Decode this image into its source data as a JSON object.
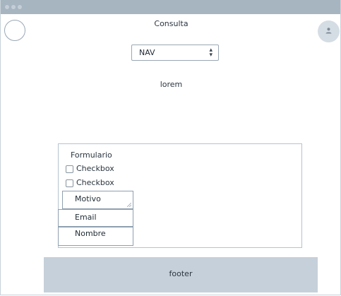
{
  "header": {
    "title": "Consulta",
    "logo_icon": "circle-logo-icon",
    "avatar_icon": "user-icon"
  },
  "nav": {
    "selected": "NAV",
    "caret_icon": "updown-caret-icon"
  },
  "main": {
    "text": "lorem"
  },
  "form": {
    "title": "Formulario",
    "checkboxes": [
      {
        "label": "Checkbox",
        "checked": false
      },
      {
        "label": "Checkbox",
        "checked": false
      }
    ],
    "motivo": "Motivo",
    "email": "Email",
    "nombre": "Nombre"
  },
  "footer": {
    "text": "footer"
  },
  "colors": {
    "titlebar": "#a7b5c1",
    "footer": "#c5d0da",
    "avatar": "#d5dde4"
  }
}
